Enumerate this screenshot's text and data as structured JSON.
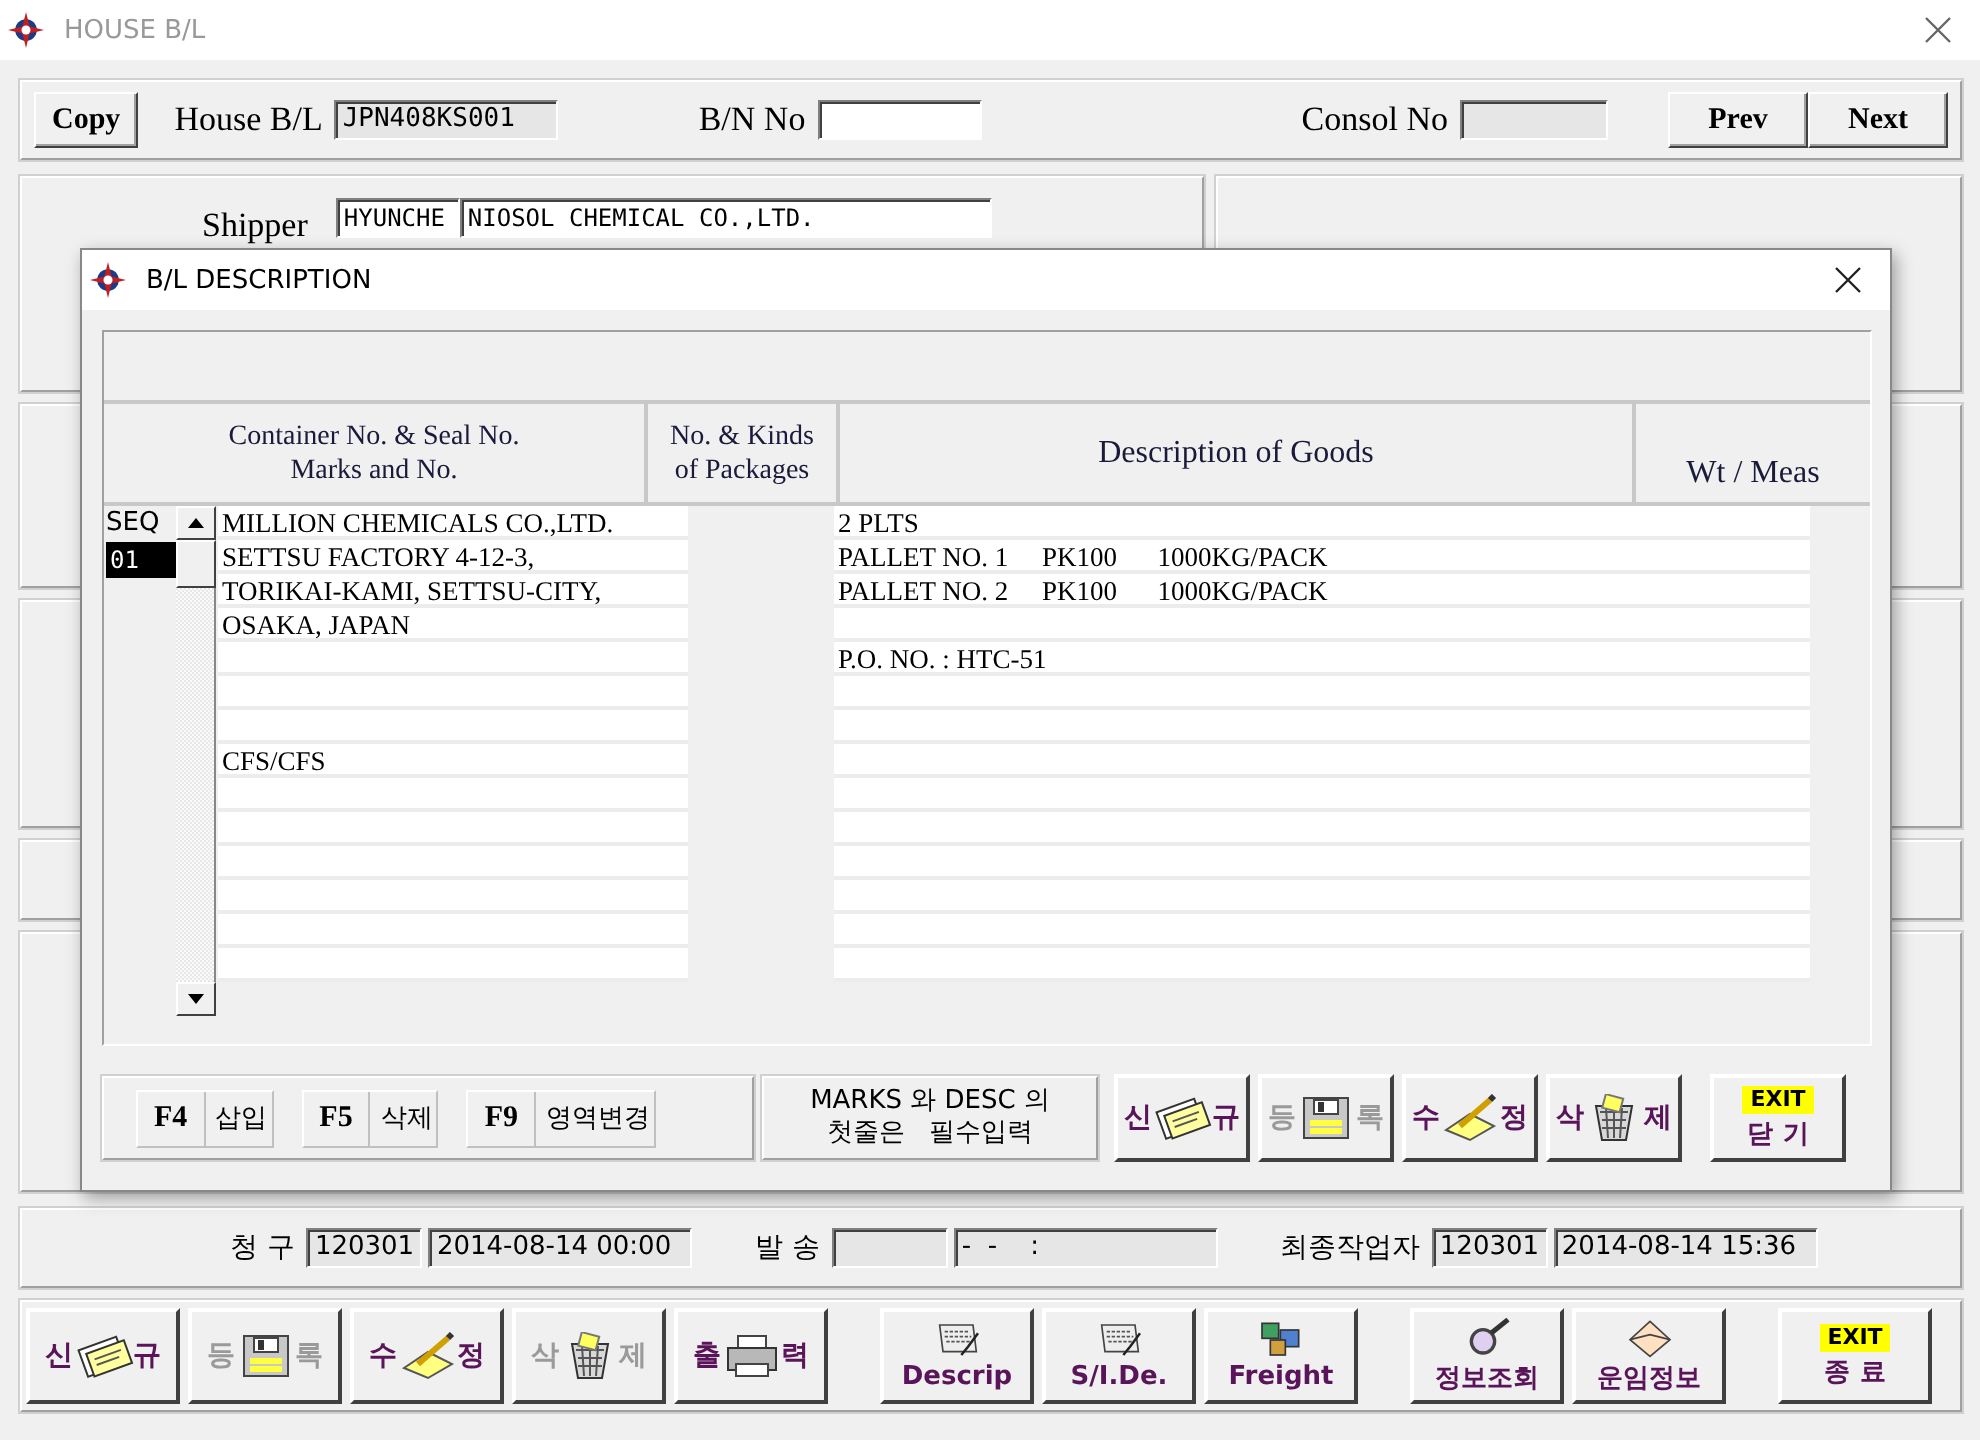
{
  "window": {
    "title": "HOUSE B/L"
  },
  "toolbar": {
    "copy": "Copy",
    "house_bl_label": "House B/L",
    "house_bl": "JPN408KS001",
    "bn_label": "B/N No",
    "consol_label": "Consol No",
    "prev": "Prev",
    "next": "Next"
  },
  "shipper": {
    "label": "Shipper",
    "code": "HYUNCHE",
    "name": "NIOSOL CHEMICAL CO.,LTD."
  },
  "dialog": {
    "title": "B/L DESCRIPTION",
    "columns": [
      "Container No. & Seal No.\nMarks and No.",
      "No. & Kinds\nof Packages",
      "Description of Goods",
      "Wt / Meas"
    ],
    "seq_label": "SEQ",
    "seq": [
      {
        "label": "01",
        "selected": true
      }
    ],
    "marks": "MILLION CHEMICALS CO.,LTD.\nSETTSU FACTORY 4-12-3,\nTORIKAI-KAMI, SETTSU-CITY,\nOSAKA, JAPAN\n\n\n\nCFS/CFS",
    "description": "2 PLTS\nPALLET NO. 1     PK100      1000KG/PACK\nPALLET NO. 2     PK100      1000KG/PACK\n\nP.O. NO. : HTC-51",
    "keys": [
      {
        "key": "F4",
        "label": "삽입"
      },
      {
        "key": "F5",
        "label": "삭제"
      },
      {
        "key": "F9",
        "label": "영역변경"
      }
    ],
    "note": "MARKS 와 DESC 의\n첫줄은   필수입력",
    "buttons": [
      {
        "label": "신 규",
        "kind": "document",
        "disabled": false
      },
      {
        "label": "등 록",
        "kind": "floppy",
        "disabled": true
      },
      {
        "label": "수 정",
        "kind": "pencil",
        "disabled": false
      },
      {
        "label": "삭 제",
        "kind": "trash",
        "disabled": false
      },
      {
        "label": "닫 기",
        "kind": "exit",
        "badge": "EXIT",
        "disabled": false
      }
    ]
  },
  "status": [
    {
      "label": "청 구",
      "fields": [
        {
          "kind": "code",
          "value": "120301"
        },
        {
          "kind": "date",
          "value": "2014-08-14 00:00"
        }
      ]
    },
    {
      "label": "발 송",
      "fields": [
        {
          "kind": "code"
        },
        {
          "kind": "date",
          "value": "-  -    :"
        }
      ]
    },
    {
      "label": "최종작업자",
      "fields": [
        {
          "kind": "code",
          "value": "120301"
        },
        {
          "kind": "date",
          "value": "2014-08-14 15:36"
        }
      ]
    }
  ],
  "buttons": [
    [
      {
        "label": "신 규",
        "kind": "document",
        "disabled": false
      },
      {
        "label": "등 록",
        "kind": "floppy",
        "disabled": true
      },
      {
        "label": "수 정",
        "kind": "pencil",
        "disabled": false
      },
      {
        "label": "삭 제",
        "kind": "trash",
        "disabled": true
      },
      {
        "label": "출 력",
        "kind": "printer",
        "disabled": false
      }
    ],
    [
      {
        "label": "Descrip",
        "kind": "scroll",
        "disabled": false
      },
      {
        "label": "S/I.De.",
        "kind": "scroll",
        "disabled": false
      },
      {
        "label": "Freight",
        "kind": "freight",
        "disabled": false
      }
    ],
    [
      {
        "label": "정보조회",
        "kind": "magnifier",
        "disabled": false
      },
      {
        "label": "운임정보",
        "kind": "envelope",
        "disabled": false
      }
    ],
    [
      {
        "label": "종 료",
        "kind": "exit",
        "badge": "EXIT",
        "disabled": false
      }
    ]
  ]
}
